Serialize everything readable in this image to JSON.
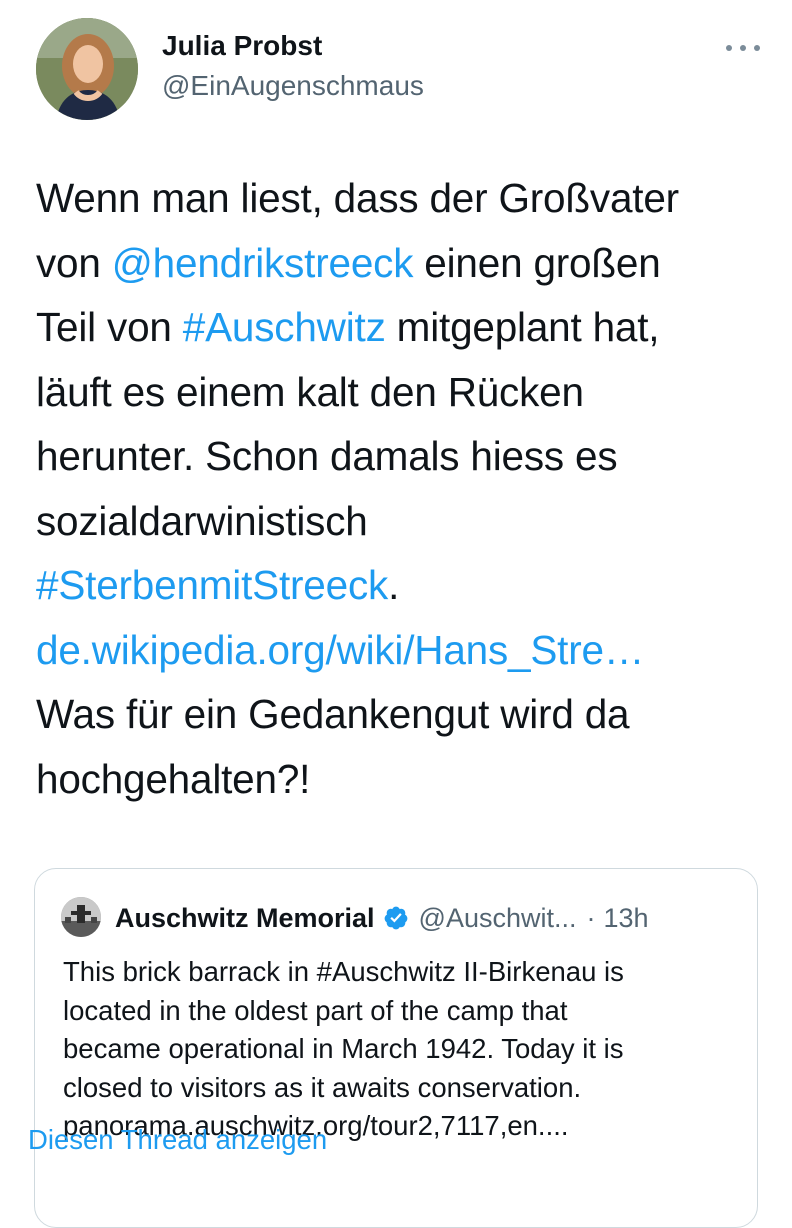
{
  "tweet": {
    "author": {
      "name": "Julia Probst",
      "handle": "@EinAugenschmaus"
    },
    "text": {
      "l1": "Wenn man liest, dass der Großvater",
      "l2_pre": "von ",
      "l2_mention": "@hendrikstreeck",
      "l2_post": " einen großen",
      "l3_pre": "Teil von ",
      "l3_hashtag": "#Auschwitz",
      "l3_post": " mitgeplant hat,",
      "l4": "läuft es einem kalt den Rücken",
      "l5": "herunter. Schon damals hiess es",
      "l6": "sozialdarwinistisch",
      "l7_hashtag": "#SterbenmitStreeck",
      "l7_post": ".",
      "l8_link": "de.wikipedia.org/wiki/Hans_Stre…",
      "l9": "Was für ein Gedankengut wird da",
      "l10": "hochgehalten?!"
    }
  },
  "quote": {
    "name": "Auschwitz Memorial",
    "handle": "@Auschwit...",
    "dot": "·",
    "time": "13h",
    "lines": [
      "This brick barrack in #Auschwitz II-Birkenau is",
      "located in the oldest part of the camp that",
      "became operational in March 1942. Today it is",
      "closed to visitors as it awaits conservation.",
      "panorama.auschwitz.org/tour2,7117,en...."
    ],
    "show_thread": "Diesen Thread anzeigen"
  },
  "colors": {
    "link": "#1d9bf0",
    "secondary": "#536471",
    "text": "#0f1419",
    "border": "#cfd9de"
  },
  "icons": {
    "more": "more-options-icon",
    "verified": "verified-badge-icon"
  }
}
